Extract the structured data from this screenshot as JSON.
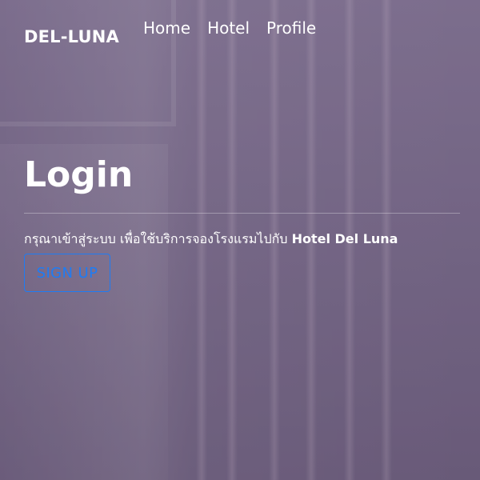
{
  "navbar": {
    "brand": "DEL-LUNA",
    "links": [
      "Home",
      "Hotel",
      "Profile"
    ]
  },
  "main": {
    "title": "Login",
    "description_prefix": "กรุณาเข้าสู่ระบบ เพื่อใช้บริการจองโรงแรมไปกับ",
    "description_hotel": "Hotel Del Luna",
    "signup_label": "SIGN UP"
  },
  "colors": {
    "accent": "#1e7cf4",
    "text": "#ffffff",
    "background": "#6e5f7e"
  }
}
